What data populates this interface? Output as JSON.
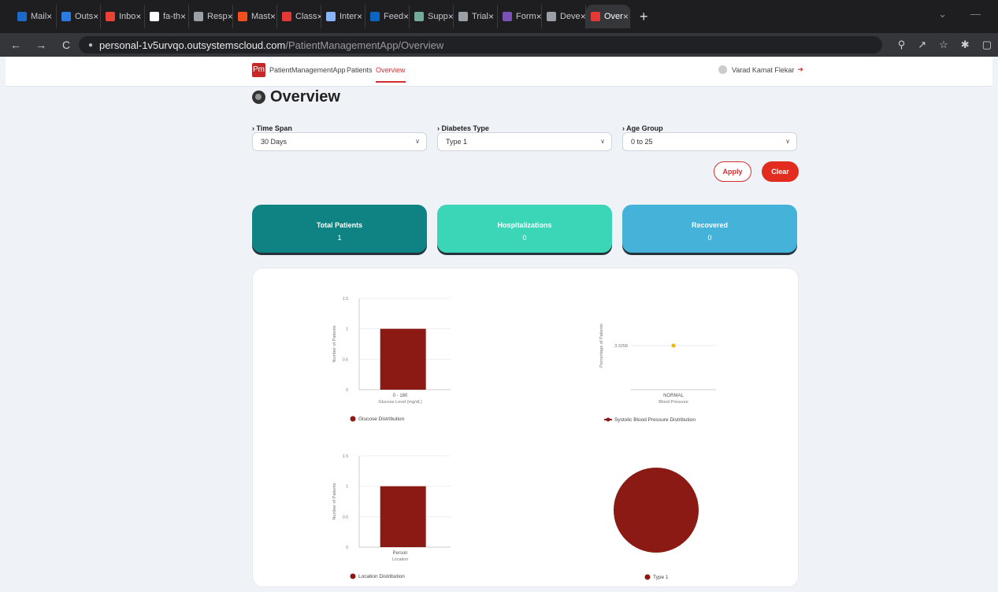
{
  "browser": {
    "tabs": [
      {
        "label": "Mail",
        "color": "#1b6ac9"
      },
      {
        "label": "Outs",
        "color": "#2a7be4"
      },
      {
        "label": "Inbo",
        "color": "#ea4335"
      },
      {
        "label": "fa-th",
        "color": "#ffffff"
      },
      {
        "label": "Resp",
        "color": "#9aa0a6"
      },
      {
        "label": "Mast",
        "color": "#f24e1e"
      },
      {
        "label": "Class",
        "color": "#e53935"
      },
      {
        "label": "Inter",
        "color": "#8ab4f8"
      },
      {
        "label": "Feed",
        "color": "#0a66c2"
      },
      {
        "label": "Supp",
        "color": "#74aa9c"
      },
      {
        "label": "Trial",
        "color": "#9aa0a6"
      },
      {
        "label": "Form",
        "color": "#7952b3"
      },
      {
        "label": "Deve",
        "color": "#9aa0a6"
      },
      {
        "label": "Over",
        "color": "#e53935"
      }
    ],
    "url_host": "personal-1v5urvqo.outsystemscloud.com",
    "url_path": "/PatientManagementApp/Overview"
  },
  "nav": {
    "logo": "Pm",
    "app_name": "PatientManagementApp",
    "patients": "Patients",
    "overview": "Overview",
    "user": "Varad Kamat Flekar"
  },
  "page": {
    "title": "Overview"
  },
  "filters": {
    "time_span": {
      "label": "Time Span",
      "value": "30 Days"
    },
    "diabetes_type": {
      "label": "Diabetes Type",
      "value": "Type 1"
    },
    "age_group": {
      "label": "Age Group",
      "value": "0 to 25"
    },
    "apply": "Apply",
    "clear": "Clear"
  },
  "kpis": [
    {
      "label": "Total Patients",
      "value": "1",
      "color": "#0f8384"
    },
    {
      "label": "Hospitalizations",
      "value": "0",
      "color": "#3bd6b7"
    },
    {
      "label": "Recovered",
      "value": "0",
      "color": "#45b2d9"
    }
  ],
  "chart_data": [
    {
      "type": "bar",
      "categories": [
        "0 - 180"
      ],
      "values": [
        1
      ],
      "xlabel": "Glucose Level (mg/dL)",
      "ylabel": "Number of Patients",
      "yticks": [
        "1.5",
        "1",
        "0.5",
        "0"
      ],
      "ylim": [
        0,
        1.5
      ],
      "legend": "Glucose Distribution",
      "color": "#8b1a14"
    },
    {
      "type": "line",
      "categories": [
        "NORMAL"
      ],
      "values": [
        3.3258
      ],
      "value_label": "3.3258",
      "xlabel": "Blood Pressure",
      "ylabel": "Percentage of Patients",
      "legend": "Systolic Blood Pressure Distribution",
      "color": "#f6b400",
      "legend_color": "#8b1a14"
    },
    {
      "type": "bar",
      "categories": [
        "Person"
      ],
      "values": [
        1
      ],
      "xlabel": "Location",
      "ylabel": "Number of Patients",
      "yticks": [
        "1.5",
        "1",
        "0.5",
        "0"
      ],
      "ylim": [
        0,
        1.5
      ],
      "legend": "Location Distribution",
      "color": "#8b1a14"
    },
    {
      "type": "pie",
      "categories": [
        "Type 1"
      ],
      "values": [
        1
      ],
      "legend": "Type 1",
      "color": "#8b1a14"
    }
  ]
}
